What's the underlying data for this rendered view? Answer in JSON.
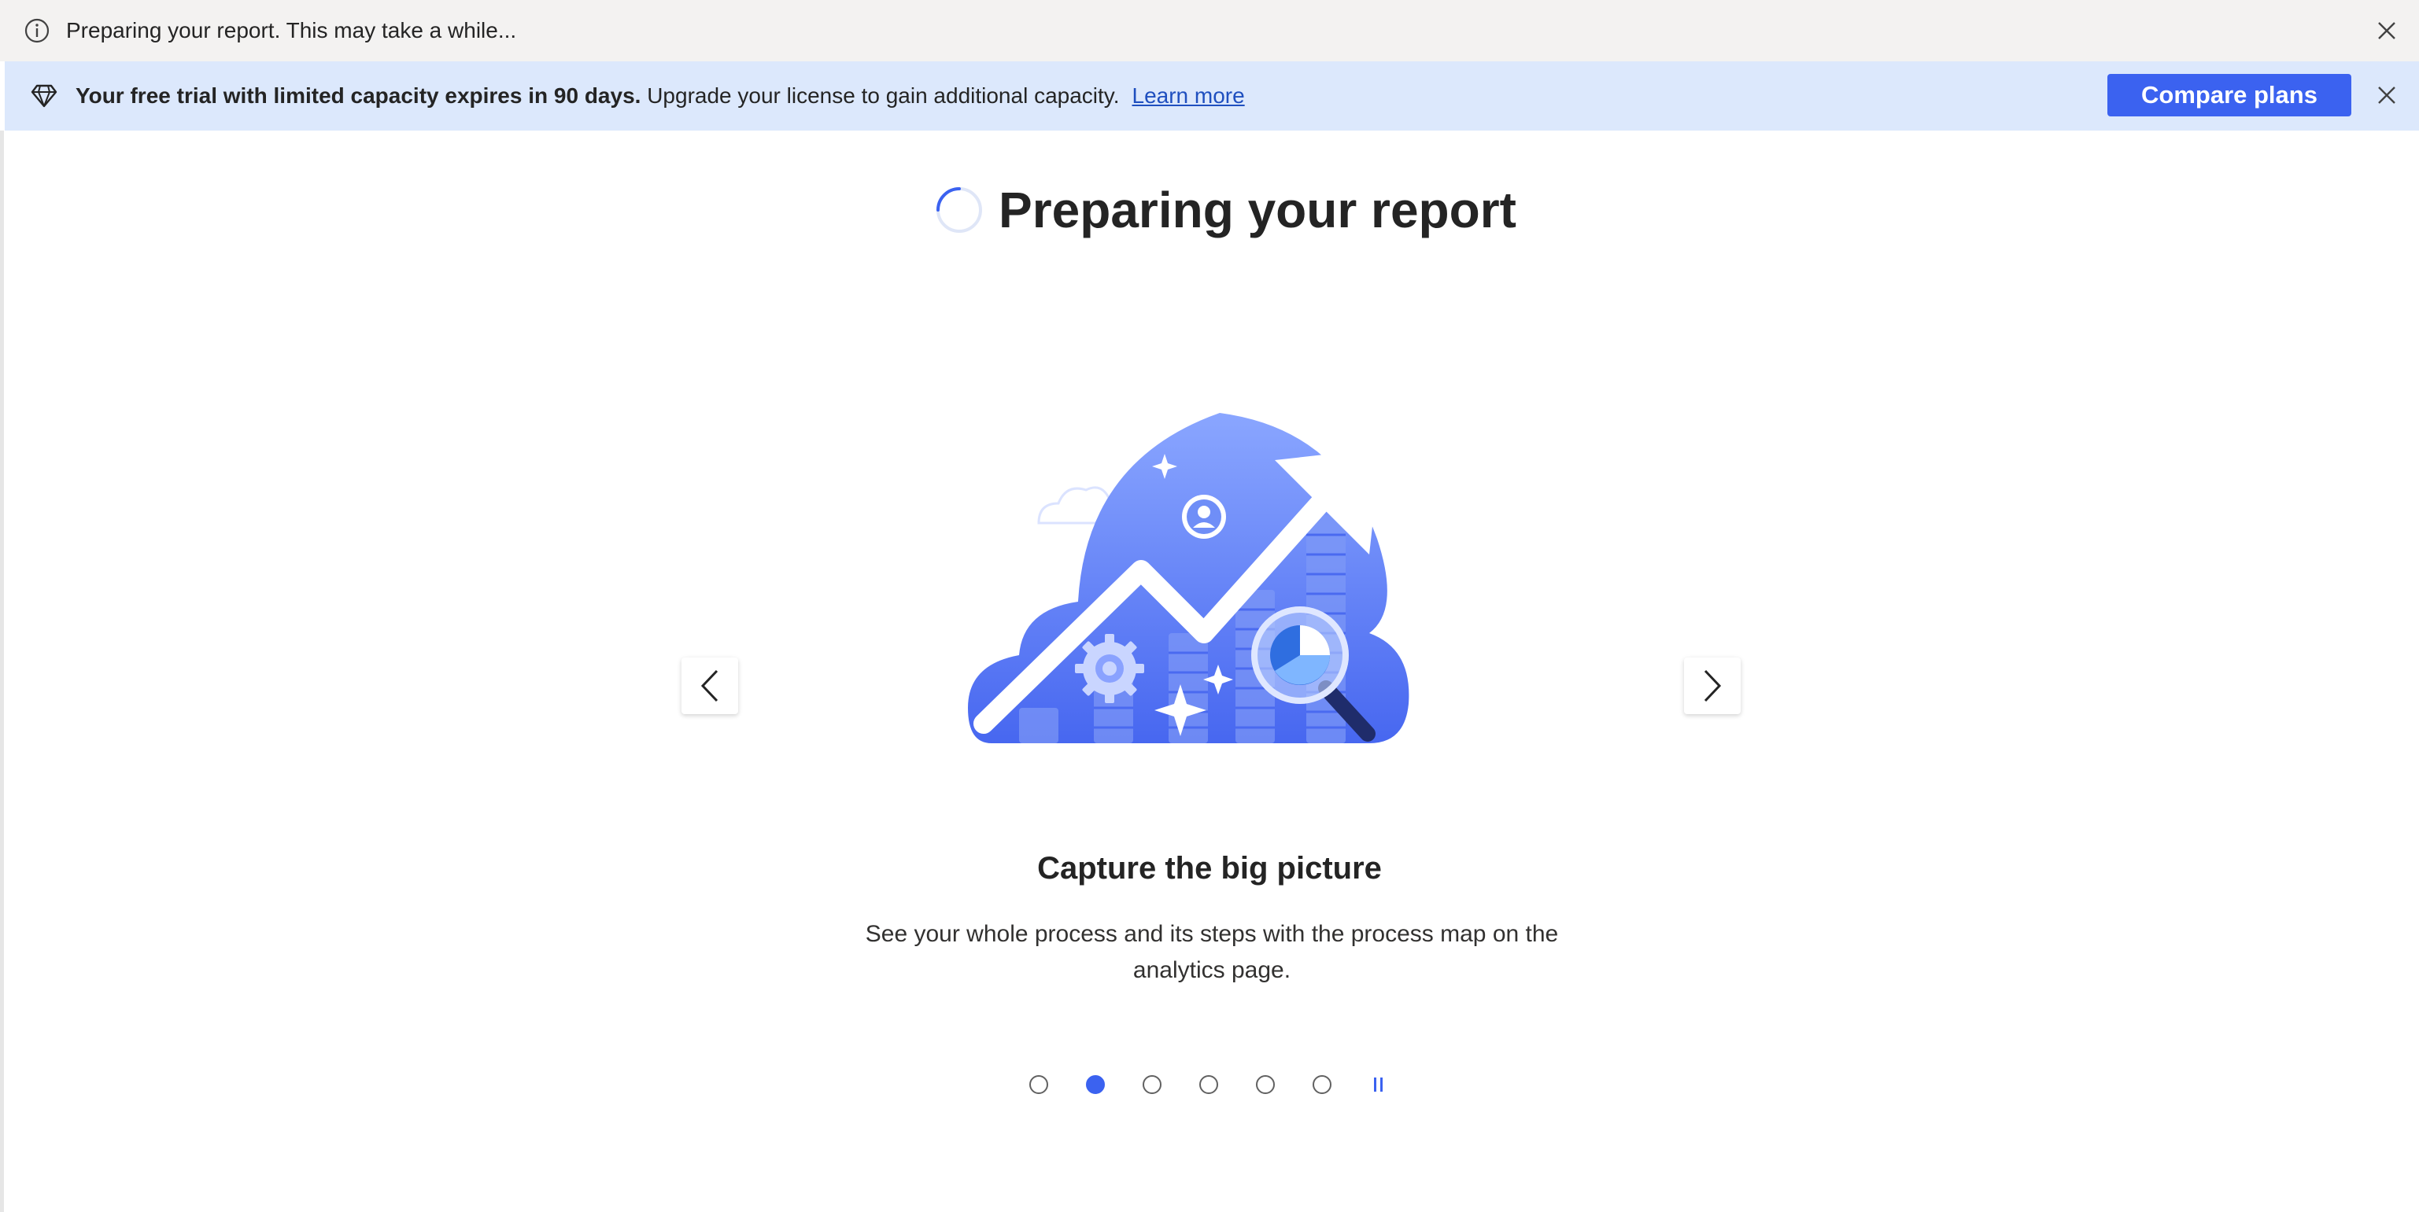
{
  "info_bar": {
    "icon": "info-icon",
    "message": "Preparing your report. This may take a while...",
    "close_icon": "close-icon"
  },
  "trial_banner": {
    "icon": "diamond-icon",
    "bold_text": "Your free trial with limited capacity expires in 90 days.",
    "text": "Upgrade your license to gain additional capacity.",
    "link_label": "Learn more",
    "button_label": "Compare plans",
    "close_icon": "close-icon",
    "background_color": "#dce8fc",
    "button_color": "#3b62f0"
  },
  "main": {
    "title": "Preparing your report",
    "spinner_icon": "loading-spinner-icon"
  },
  "carousel": {
    "illustration": "cloud-analytics-illustration",
    "prev_icon": "chevron-left-icon",
    "next_icon": "chevron-right-icon",
    "heading": "Capture the big picture",
    "description": "See your whole process and its steps with the process map on the analytics page.",
    "slide_count": 6,
    "active_index": 1,
    "pause_icon": "pause-icon",
    "accent_color": "#3b62f0"
  }
}
